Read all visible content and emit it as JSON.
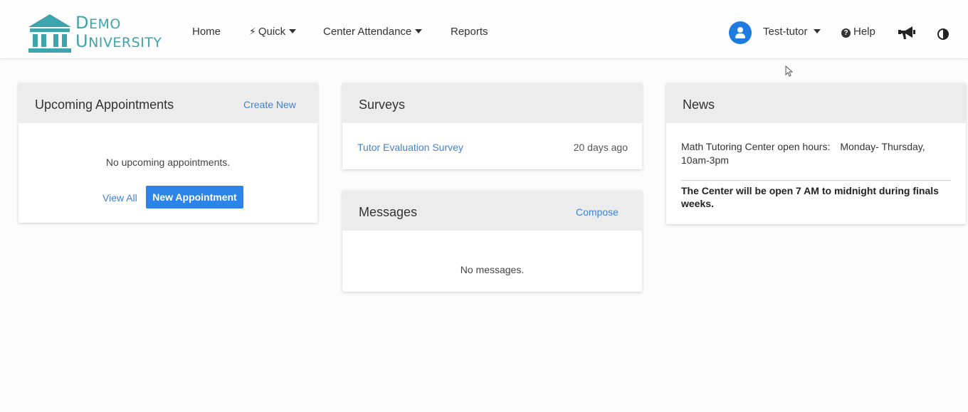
{
  "brand": {
    "line1_initial": "D",
    "line1_rest": "EMO",
    "line2_initial": "U",
    "line2_rest": "NIVERSITY",
    "color": "#3ea4ad"
  },
  "nav": {
    "home": "Home",
    "quick": "Quick",
    "center_attendance": "Center Attendance",
    "reports": "Reports",
    "user": "Test-tutor",
    "help": "Help",
    "help_icon_glyph": "?"
  },
  "appointments": {
    "title": "Upcoming Appointments",
    "create_new": "Create New",
    "empty": "No upcoming appointments.",
    "view_all": "View All",
    "new_appointment": "New Appointment"
  },
  "surveys": {
    "title": "Surveys",
    "items": [
      {
        "name": "Tutor Evaluation Survey",
        "age": "20 days ago"
      }
    ]
  },
  "messages": {
    "title": "Messages",
    "compose": "Compose",
    "empty": "No messages."
  },
  "news": {
    "title": "News",
    "items": [
      {
        "text_a": "Math Tutoring Center open hours:",
        "text_b": "Monday- Thursday,",
        "text_c": "10am-3pm"
      },
      {
        "text": "The Center will be open 7 AM to midnight during finals weeks."
      }
    ]
  },
  "colors": {
    "accent": "#2c83e8",
    "link": "#3f83d8",
    "header_bg": "#ececec",
    "avatar": "#1e7be0"
  },
  "icons": [
    "university-logo-icon",
    "bolt-icon",
    "caret-down-icon",
    "user-avatar-icon",
    "question-circle-icon",
    "megaphone-icon",
    "contrast-icon",
    "mouse-cursor-icon"
  ]
}
